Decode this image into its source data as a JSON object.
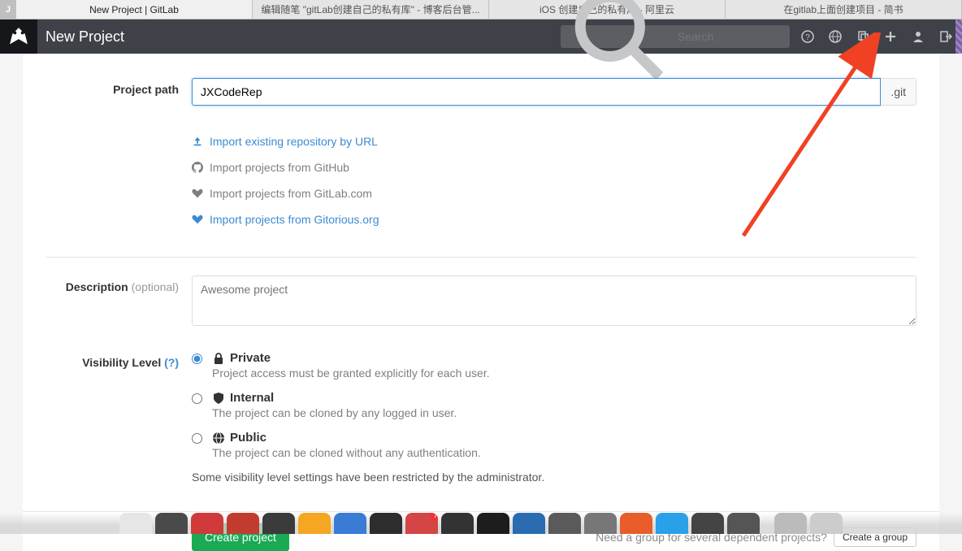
{
  "browser": {
    "tabs": [
      {
        "label": "New Project | GitLab"
      },
      {
        "label": "编辑随笔 \"gitLab创建自己的私有库\" - 博客后台管..."
      },
      {
        "label": "iOS 创建自己的私有库 - 阿里云"
      },
      {
        "label": "在gitlab上面创建项目 - 简书"
      }
    ],
    "prefix": "J"
  },
  "header": {
    "title": "New Project",
    "search_placeholder": "Search"
  },
  "form": {
    "project_path": {
      "label": "Project path",
      "value": "JXCodeRep",
      "suffix": ".git"
    },
    "imports": {
      "by_url": "Import existing repository by URL",
      "github": "Import projects from GitHub",
      "gitlab_com": "Import projects from GitLab.com",
      "gitorious": "Import projects from Gitorious.org"
    },
    "description": {
      "label": "Description",
      "optional": "(optional)",
      "placeholder": "Awesome project"
    },
    "visibility": {
      "label": "Visibility Level",
      "help": "(?)",
      "options": {
        "private": {
          "title": "Private",
          "desc": "Project access must be granted explicitly for each user."
        },
        "internal": {
          "title": "Internal",
          "desc": "The project can be cloned by any logged in user."
        },
        "public": {
          "title": "Public",
          "desc": "The project can be cloned without any authentication."
        }
      },
      "note": "Some visibility level settings have been restricted by the administrator."
    },
    "create_button": "Create project",
    "group_hint": "Need a group for several dependent projects?",
    "create_group_button": "Create a group"
  }
}
